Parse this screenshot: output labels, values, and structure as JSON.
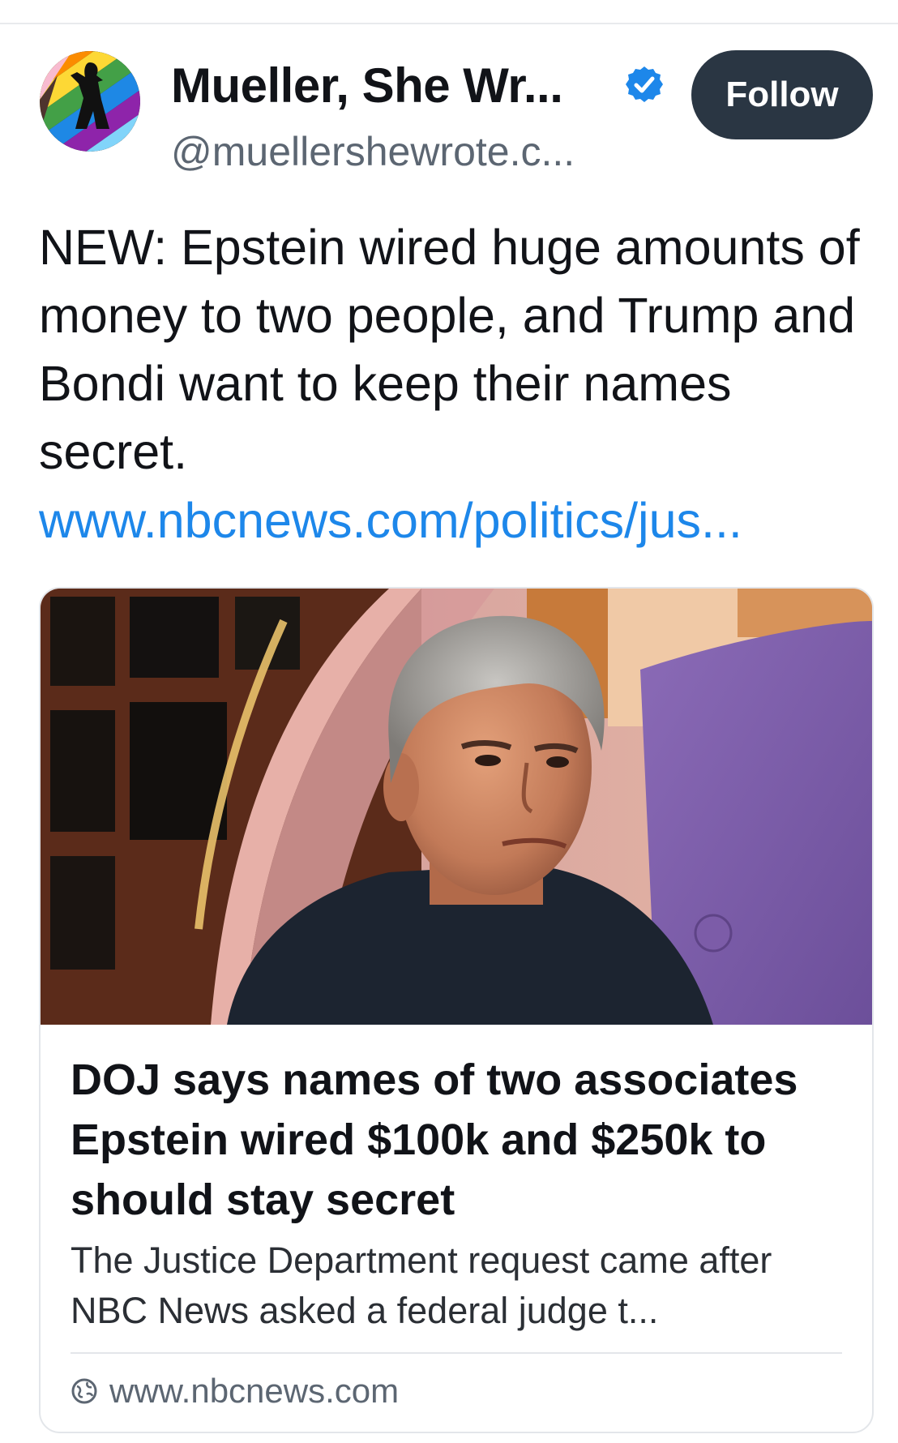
{
  "author": {
    "display_name": "Mueller, She Wr...",
    "handle": "@muellershewrote.c...",
    "verified": true,
    "avatar_icon": "rainbow-silhouette-avatar"
  },
  "actions": {
    "follow_label": "Follow"
  },
  "post": {
    "text": "NEW: Epstein wired huge amounts of money to two people, and Trump and Bondi want to keep their names secret.",
    "link_text": "www.nbcnews.com/politics/jus..."
  },
  "link_card": {
    "image_description_icon": "article-photo",
    "title": "DOJ says names of two associates Epstein wired $100k and $250k to should stay secret",
    "description": "The Justice Department request came after NBC News asked a federal judge t...",
    "domain": "www.nbcnews.com",
    "domain_icon": "globe-icon"
  },
  "colors": {
    "link": "#1d87ea",
    "follow_button_bg": "#2a3643",
    "verified_badge": "#1d87ea",
    "secondary_text": "#5c6672"
  }
}
